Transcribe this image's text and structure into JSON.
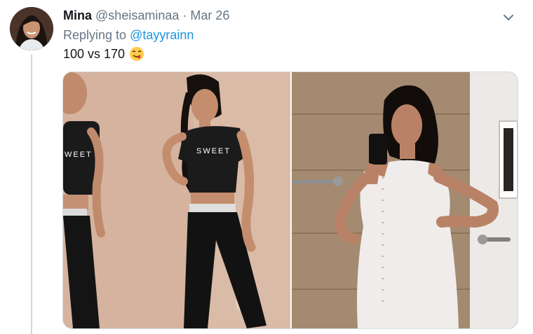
{
  "tweet": {
    "author_name": "Mina",
    "author_handle": "@sheisaminaa",
    "separator": "·",
    "date": "Mar 26",
    "replying_prefix": "Replying to",
    "replying_to": "@tayyrainn",
    "text": "100 vs 170",
    "emoji_icon": "yum-face-emoji",
    "menu_icon": "chevron-down-icon"
  },
  "media": {
    "left_photo": {
      "shirt_text_front": "SWEET",
      "shirt_text_mirror": "WEET"
    }
  },
  "colors": {
    "link_blue": "#1b95e0",
    "secondary_text": "#657786",
    "thread_line": "#cfd9de"
  }
}
